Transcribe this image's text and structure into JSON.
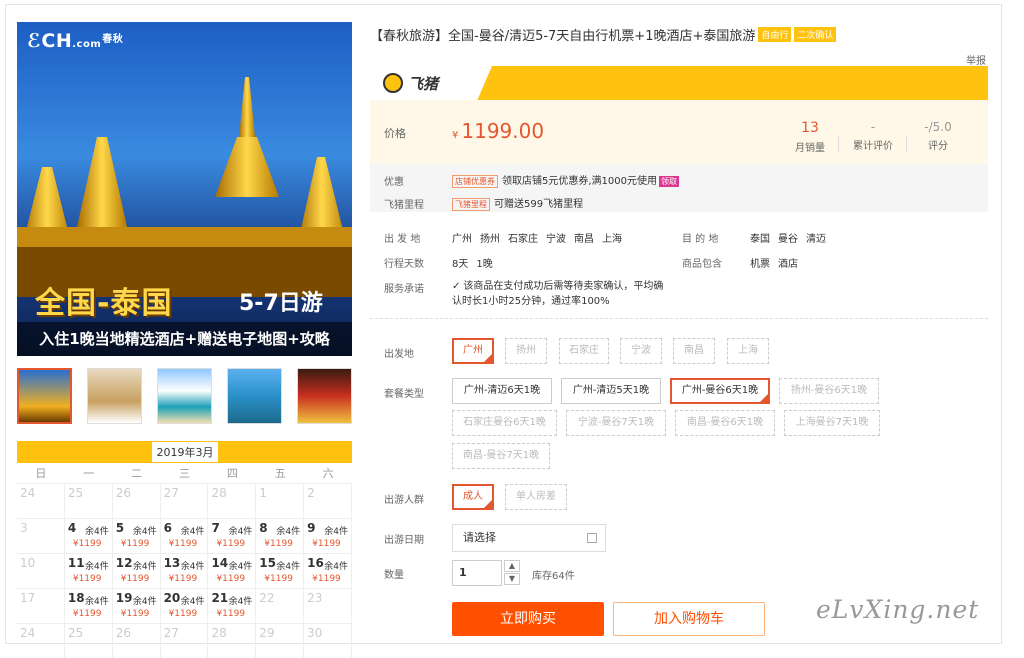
{
  "hero": {
    "logo": "CH",
    "logo_cn": "春秋",
    "logo_com": ".com",
    "title": "全国-泰国",
    "days": "5-7日游",
    "subtitle": "入住1晚当地精选酒店+赠送电子地图+攻略"
  },
  "calendar": {
    "month": "2019年3月",
    "weekdays": [
      "日",
      "一",
      "二",
      "三",
      "四",
      "五",
      "六"
    ],
    "stock_label": "余4件",
    "price_label": "¥1199",
    "rows": [
      [
        {
          "d": "24"
        },
        {
          "d": "25"
        },
        {
          "d": "26"
        },
        {
          "d": "27"
        },
        {
          "d": "28"
        },
        {
          "d": "1"
        },
        {
          "d": "2"
        }
      ],
      [
        {
          "d": "3"
        },
        {
          "d": "4",
          "on": true
        },
        {
          "d": "5",
          "on": true
        },
        {
          "d": "6",
          "on": true
        },
        {
          "d": "7",
          "on": true
        },
        {
          "d": "8",
          "on": true
        },
        {
          "d": "9",
          "on": true
        }
      ],
      [
        {
          "d": "10"
        },
        {
          "d": "11",
          "on": true
        },
        {
          "d": "12",
          "on": true
        },
        {
          "d": "13",
          "on": true
        },
        {
          "d": "14",
          "on": true
        },
        {
          "d": "15",
          "on": true
        },
        {
          "d": "16",
          "on": true
        }
      ],
      [
        {
          "d": "17"
        },
        {
          "d": "18",
          "on": true
        },
        {
          "d": "19",
          "on": true
        },
        {
          "d": "20",
          "on": true
        },
        {
          "d": "21",
          "on": true
        },
        {
          "d": "22"
        },
        {
          "d": "23"
        }
      ],
      [
        {
          "d": "24"
        },
        {
          "d": "25"
        },
        {
          "d": "26"
        },
        {
          "d": "27"
        },
        {
          "d": "28"
        },
        {
          "d": "29"
        },
        {
          "d": "30"
        }
      ]
    ]
  },
  "product": {
    "title": "【春秋旅游】全国-曼谷/清迈5-7天自由行机票+1晚酒店+泰国旅游",
    "tag1": "自由行",
    "tag2": "二次确认",
    "report": "举报",
    "platform": "飞猪"
  },
  "price": {
    "label": "价格",
    "currency": "¥",
    "value": "1199.00",
    "sales_n": "13",
    "sales_l": "月销量",
    "reviews_n": "-",
    "reviews_l": "累计评价",
    "score_n": "-/5.0",
    "score_l": "评分"
  },
  "promo": {
    "label1": "优惠",
    "tag1": "店铺优惠券",
    "text1": "领取店铺5元优惠券,满1000元使用",
    "link1": "领取",
    "label2": "飞猪里程",
    "tag2": "飞猪里程",
    "text2": "可赠送599飞猪里程"
  },
  "info": {
    "depart_label": "出 发 地",
    "depart_cities": [
      "广州",
      "扬州",
      "石家庄",
      "宁波",
      "南昌",
      "上海"
    ],
    "dest_label": "目 的 地",
    "dest_cities": [
      "泰国",
      "曼谷",
      "清迈"
    ],
    "days_label": "行程天数",
    "days": [
      "8天",
      "1晚"
    ],
    "includes_label": "商品包含",
    "includes": [
      "机票",
      "酒店"
    ],
    "service_label": "服务承诺",
    "service_line1": "该商品在支付成功后需等待卖家确认，平均确",
    "service_line2": "认时长1小时25分钟，通过率100%"
  },
  "options": {
    "depart_label": "出发地",
    "departs": [
      "广州",
      "扬州",
      "石家庄",
      "宁波",
      "南昌",
      "上海"
    ],
    "package_label": "套餐类型",
    "packages": [
      "广州-清迈6天1晚",
      "广州-清迈5天1晚",
      "广州-曼谷6天1晚",
      "扬州-曼谷6天1晚",
      "石家庄曼谷6天1晚",
      "宁波-曼谷7天1晚",
      "南昌-曼谷6天1晚",
      "上海曼谷7天1晚",
      "南昌-曼谷7天1晚"
    ],
    "people_label": "出游人群",
    "people": [
      "成人",
      "单人房差"
    ],
    "date_label": "出游日期",
    "date_placeholder": "请选择",
    "qty_label": "数量",
    "qty_value": "1",
    "stock": "库存64件"
  },
  "actions": {
    "buy": "立即购买",
    "cart": "加入购物车"
  },
  "watermark": "eLvXing.net",
  "colors": {
    "accent": "#ff5000",
    "yellow": "#ffc20e",
    "price": "#e4572e"
  }
}
